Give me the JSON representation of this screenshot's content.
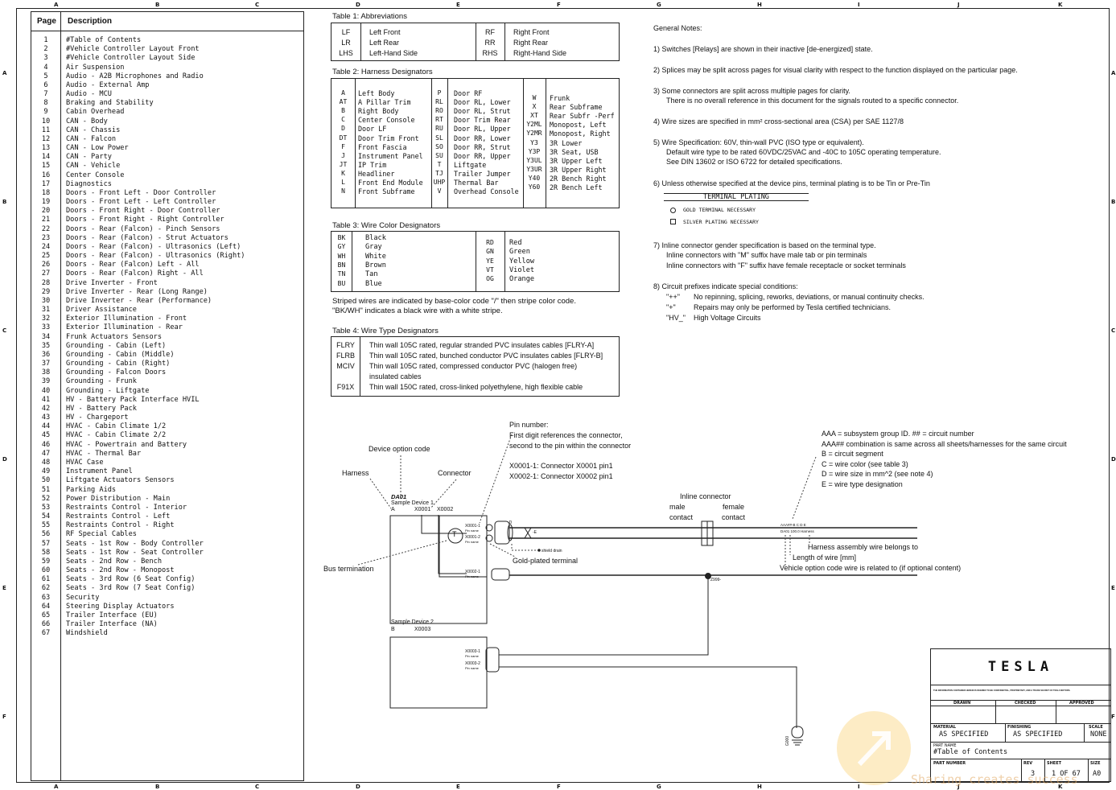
{
  "grid": {
    "columns": [
      "A",
      "B",
      "C",
      "D",
      "E",
      "F",
      "G",
      "H",
      "I",
      "J",
      "K"
    ],
    "rows": [
      "A",
      "B",
      "C",
      "D",
      "E",
      "F"
    ]
  },
  "toc": {
    "header_page": "Page",
    "header_description": "Description",
    "items": [
      "#Table of Contents",
      "#Vehicle Controller Layout Front",
      "#Vehicle Controller Layout Side",
      "Air Suspension",
      "Audio - A2B Microphones and Radio",
      "Audio - External Amp",
      "Audio - MCU",
      "Braking and Stability",
      "Cabin Overhead",
      "CAN - Body",
      "CAN - Chassis",
      "CAN - Falcon",
      "CAN - Low Power",
      "CAN - Party",
      "CAN - Vehicle",
      "Center Console",
      "Diagnostics",
      "Doors - Front Left - Door Controller",
      "Doors - Front Left - Left Controller",
      "Doors - Front Right - Door Controller",
      "Doors - Front Right - Right Controller",
      "Doors - Rear (Falcon) - Pinch Sensors",
      "Doors - Rear (Falcon) - Strut Actuators",
      "Doors - Rear (Falcon) - Ultrasonics (Left)",
      "Doors - Rear (Falcon) - Ultrasonics (Right)",
      "Doors - Rear (Falcon) Left - All",
      "Doors - Rear (Falcon) Right - All",
      "Drive Inverter - Front",
      "Drive Inverter - Rear (Long Range)",
      "Drive Inverter - Rear (Performance)",
      "Driver Assistance",
      "Exterior Illumination - Front",
      "Exterior Illumination - Rear",
      "Frunk Actuators Sensors",
      "Grounding - Cabin (Left)",
      "Grounding - Cabin (Middle)",
      "Grounding - Cabin (Right)",
      "Grounding - Falcon Doors",
      "Grounding - Frunk",
      "Grounding - Liftgate",
      "HV - Battery Pack Interface HVIL",
      "HV - Battery Pack",
      "HV - Chargeport",
      "HVAC - Cabin Climate 1/2",
      "HVAC - Cabin Climate 2/2",
      "HVAC - Powertrain and Battery",
      "HVAC - Thermal Bar",
      "HVAC Case",
      "Instrument Panel",
      "Liftgate Actuators Sensors",
      "Parking Aids",
      "Power Distribution - Main",
      "Restraints Control - Interior",
      "Restraints Control - Left",
      "Restraints Control - Right",
      "RF Special Cables",
      "Seats - 1st Row - Body Controller",
      "Seats - 1st Row - Seat Controller",
      "Seats - 2nd Row - Bench",
      "Seats - 2nd Row - Monopost",
      "Seats - 3rd Row (6 Seat Config)",
      "Seats - 3rd Row (7 Seat Config)",
      "Security",
      "Steering Display Actuators",
      "Trailer Interface (EU)",
      "Trailer Interface (NA)",
      "Windshield"
    ]
  },
  "table1": {
    "caption": "Table 1: Abbreviations",
    "left": [
      [
        "LF",
        "Left Front"
      ],
      [
        "LR",
        "Left Rear"
      ],
      [
        "LHS",
        "Left-Hand Side"
      ]
    ],
    "right": [
      [
        "RF",
        "Right Front"
      ],
      [
        "RR",
        "Right Rear"
      ],
      [
        "RHS",
        "Right-Hand Side"
      ]
    ]
  },
  "table2": {
    "caption": "Table 2: Harness Designators",
    "col1": [
      [
        "A",
        "Left Body"
      ],
      [
        "AT",
        "A Pillar Trim"
      ],
      [
        "B",
        "Right Body"
      ],
      [
        "C",
        "Center Console"
      ],
      [
        "D",
        "Door LF"
      ],
      [
        "DT",
        "Door Trim Front"
      ],
      [
        "F",
        "Front Fascia"
      ],
      [
        "J",
        "Instrument Panel"
      ],
      [
        "JT",
        "IP Trim"
      ],
      [
        "K",
        "Headliner"
      ],
      [
        "L",
        "Front End Module"
      ],
      [
        "N",
        "Front Subframe"
      ]
    ],
    "col2": [
      [
        "P",
        "Door RF"
      ],
      [
        "RL",
        "Door RL, Lower"
      ],
      [
        "RO",
        "Door RL, Strut"
      ],
      [
        "RT",
        "Door Trim Rear"
      ],
      [
        "RU",
        "Door RL, Upper"
      ],
      [
        "SL",
        "Door RR, Lower"
      ],
      [
        "SO",
        "Door RR, Strut"
      ],
      [
        "SU",
        "Door RR, Upper"
      ],
      [
        "T",
        "Liftgate"
      ],
      [
        "TJ",
        "Trailer Jumper"
      ],
      [
        "UHP",
        "Thermal Bar"
      ],
      [
        "V",
        "Overhead Console"
      ]
    ],
    "col3": [
      [
        "W",
        "Frunk"
      ],
      [
        "X",
        "Rear Subframe"
      ],
      [
        "XT",
        "Rear Subfr -Perf"
      ],
      [
        "Y2ML",
        "Monopost, Left"
      ],
      [
        "Y2MR",
        "Monopost, Right"
      ],
      [
        "Y3",
        "3R Lower"
      ],
      [
        "Y3P",
        "3R Seat, USB"
      ],
      [
        "Y3UL",
        "3R Upper Left"
      ],
      [
        "Y3UR",
        "3R Upper Right"
      ],
      [
        "Y40",
        "2R Bench Right"
      ],
      [
        "Y60",
        "2R Bench Left"
      ]
    ]
  },
  "table3": {
    "caption": "Table 3: Wire Color Designators",
    "left": [
      [
        "BK",
        "Black"
      ],
      [
        "GY",
        "Gray"
      ],
      [
        "WH",
        "White"
      ],
      [
        "BN",
        "Brown"
      ],
      [
        "TN",
        "Tan"
      ],
      [
        "BU",
        "Blue"
      ]
    ],
    "right": [
      [
        "RD",
        "Red"
      ],
      [
        "GN",
        "Green"
      ],
      [
        "YE",
        "Yellow"
      ],
      [
        "VT",
        "Violet"
      ],
      [
        "OG",
        "Orange"
      ]
    ],
    "note1": "Striped wires are indicated by base-color code \"/\" then stripe color code.",
    "note2": "\"BK/WH\" indicates a black wire with a white stripe."
  },
  "table4": {
    "caption": "Table 4: Wire Type Designators",
    "rows": [
      [
        "FLRY",
        "Thin wall 105C rated, regular stranded PVC insulates cables [FLRY-A]"
      ],
      [
        "FLRB",
        "Thin wall 105C rated, bunched conductor PVC insulates cables [FLRY-B]"
      ],
      [
        "MCIV",
        "Thin wall 105C rated, compressed conductor PVC (halogen free)"
      ],
      [
        "",
        "insulated cables"
      ],
      [
        "F91X",
        "Thin wall 150C rated, cross-linked polyethylene, high flexible cable"
      ]
    ]
  },
  "notes": {
    "title": "General Notes:",
    "n1": "1) Switches [Relays] are shown in their inactive [de-energized] state.",
    "n2": "2) Splices may be split across pages for visual clarity with respect to the function displayed on the particular page.",
    "n3a": "3) Some connectors are split across multiple pages for clarity.",
    "n3b": "There is no overall reference in this document for the signals routed to a specific connector.",
    "n4": "4) Wire sizes are specified in mm² cross-sectional area (CSA) per SAE 1127/8",
    "n5a": "5) Wire Specification: 60V, thin-wall PVC (ISO type or equivalent).",
    "n5b": "Default wire type to be rated 60VDC/25VAC and -40C to 105C operating temperature.",
    "n5c": "See DIN 13602 or ISO 6722 for detailed specifications.",
    "n6": "6) Unless otherwise specified at the device pins, terminal plating is to be Tin or Pre-Tin",
    "plating_title": "TERMINAL PLATING",
    "plating_gold": "GOLD TERMINAL NECESSARY",
    "plating_silver": "SILVER PLATING NECESSARY",
    "n7a": "7) Inline connector gender specification is based on the terminal type.",
    "n7b": "Inline connectors with \"M\" suffix have male tab or pin terminals",
    "n7c": "Inline connectors with \"F\" suffix have female receptacle or socket terminals",
    "n8": "8) Circuit prefixes indicate special conditions:",
    "n8a_sym": "\"++\"",
    "n8a": "No repinning, splicing, reworks, deviations, or manual continuity checks.",
    "n8b_sym": "\"+\"",
    "n8b": "Repairs may only be performed by Tesla certified technicians.",
    "n8c_sym": "\"HV_\"",
    "n8c": "High Voltage Circuits"
  },
  "diagram": {
    "pin_number_title": "Pin number:",
    "pin_number_l1": "First digit references the connector,",
    "pin_number_l2": "second to the pin within the connector",
    "pin_ex1": "X0001-1: Connector X0001 pin1",
    "pin_ex2": "X0002-1: Connector X0002 pin1",
    "device_option_code": "Device option code",
    "harness": "Harness",
    "connector": "Connector",
    "device1_code": "DA01",
    "device1_name": "Sample Device 1",
    "device1_harness": "A",
    "device1_conn1": "X0001",
    "device1_conn2": "X0002",
    "pin1": "X0001-1",
    "pin2": "X0001-2",
    "pin3": "X0002-1",
    "pin_name": "Pin name",
    "termination_symbol": "T",
    "bus_termination": "Bus termination",
    "gold_plated": "Gold-plated terminal",
    "shield_drain": "shield drain",
    "shield_d": "-D",
    "twist_e": "-E",
    "inline_title": "Inline connector",
    "male_contact_1": "male",
    "male_contact_2": "contact",
    "female_contact_1": "female",
    "female_contact_2": "contact",
    "splice_label": "Z999-",
    "device2_name": "Sample Device 2",
    "device2_harness": "B",
    "device2_conn": "X0003",
    "pin4": "X0003-1",
    "pin5": "X0003-2",
    "wire_label_top": "AAA##-B  C  D  E",
    "wire_label_bot": "DA01  100.0  Harness",
    "legend": [
      "AAA = subsystem group ID. ## = circuit number",
      "AAA## combination is same across all sheets/harnesses for the same circuit",
      "B = circuit segment",
      "C = wire color (see table 3)",
      "D = wire size in mm^2 (see note 4)",
      "E = wire type designation"
    ],
    "harness_assembly": "Harness assembly wire belongs to",
    "length_of_wire": "Length of wire [mm]",
    "vehicle_option": "Vehicle option code wire is related to (if optional content)",
    "ground_label": "G000"
  },
  "title_block": {
    "logo": "TESLA",
    "disclaimer": "THE INFORMATION CONTAINED HEREIN IS DEEMED TO BE CONFIDENTIAL, PROPRIETARY, AND A TRADE SECRET OF TESLA MOTORS.",
    "drawn": "DRAWN",
    "checked": "CHECKED",
    "approved": "APPROVED",
    "material_label": "MATERIAL",
    "material": "AS SPECIFIED",
    "finishing_label": "FINISHING",
    "finishing": "AS SPECIFIED",
    "scale_label": "SCALE",
    "scale": "NONE",
    "part_name_label": "PART NAME",
    "part_name": "#Table of Contents",
    "part_number_label": "PART NUMBER",
    "rev_label": "REV",
    "rev": "3",
    "sheet_label": "SHEET",
    "sheet": "1 OF 67",
    "size_label": "SIZE",
    "size": "A0"
  },
  "watermark": "Sharing creates success"
}
